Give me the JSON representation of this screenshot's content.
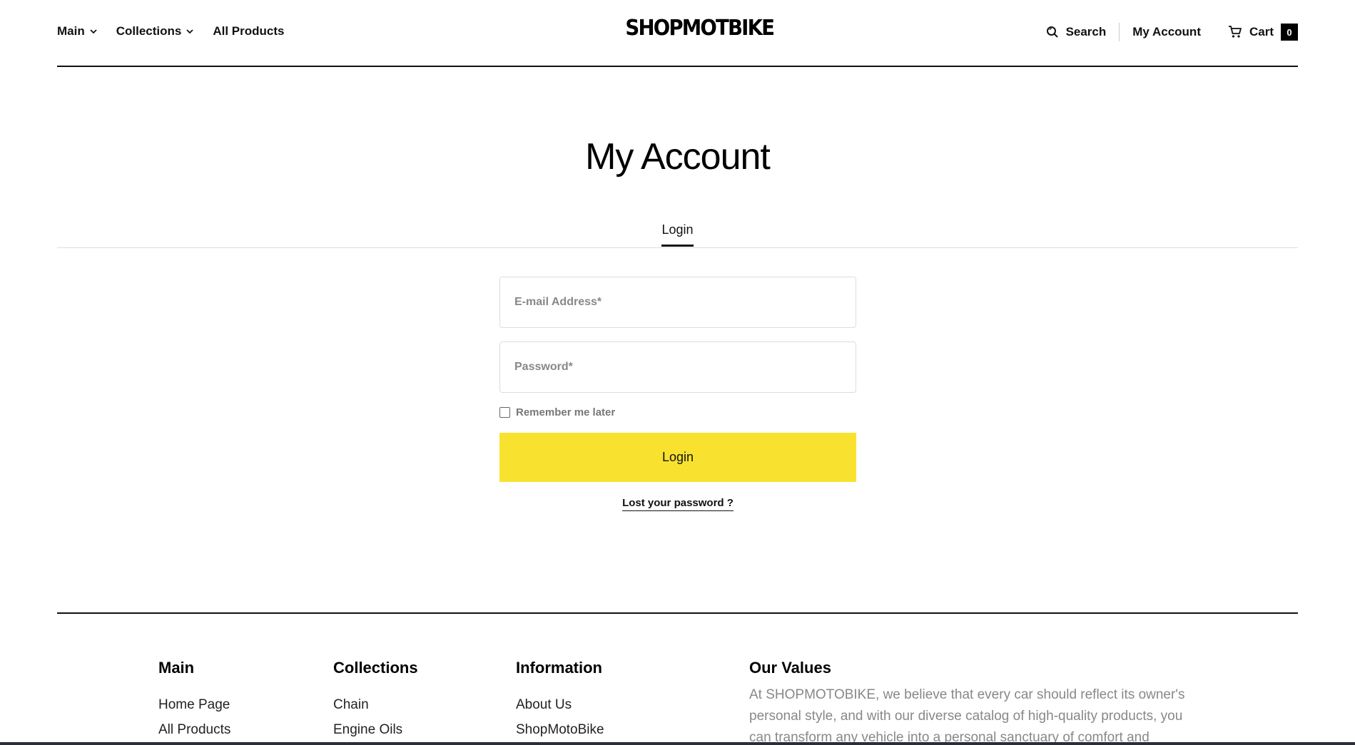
{
  "header": {
    "nav_left": [
      {
        "label": "Main",
        "has_dropdown": true
      },
      {
        "label": "Collections",
        "has_dropdown": true
      },
      {
        "label": "All Products",
        "has_dropdown": false
      }
    ],
    "logo": "SHOPMOTBIKE",
    "search_label": "Search",
    "account_label": "My Account",
    "cart_label": "Cart",
    "cart_count": "0"
  },
  "main": {
    "title": "My Account",
    "tabs": [
      {
        "label": "Login",
        "active": true
      }
    ],
    "form": {
      "email_placeholder": "E-mail Address*",
      "password_placeholder": "Password*",
      "remember_label": "Remember me later",
      "remember_checked": false,
      "login_button": "Login",
      "lost_password": "Lost your password ?"
    }
  },
  "footer": {
    "main": {
      "heading": "Main",
      "links": [
        "Home Page",
        "All Products"
      ]
    },
    "collections": {
      "heading": "Collections",
      "links": [
        "Chain",
        "Engine Oils"
      ]
    },
    "information": {
      "heading": "Information",
      "links": [
        "About Us",
        "ShopMotoBike"
      ]
    },
    "values": {
      "heading": "Our Values",
      "text": "At SHOPMOTOBIKE, we believe that every car should reflect its owner's personal style, and with our diverse catalog of high-quality products, you can transform any vehicle into a personal sanctuary of comfort and"
    }
  },
  "colors": {
    "accent": "#f9e22f",
    "text": "#111111",
    "muted": "#888888"
  }
}
